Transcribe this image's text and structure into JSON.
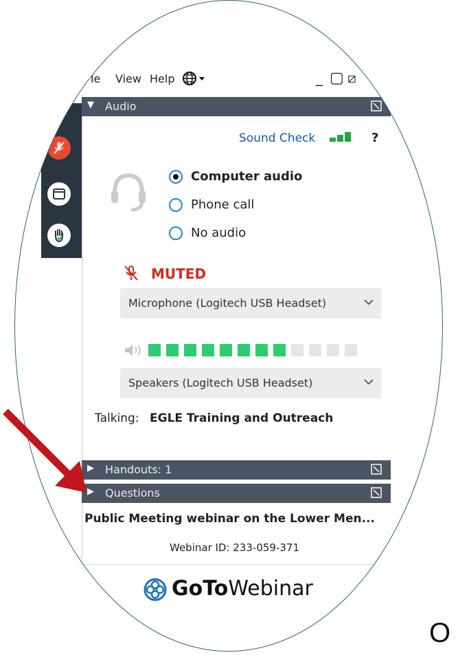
{
  "menubar": {
    "items": [
      "le",
      "View",
      "Help"
    ],
    "globe_icon": "globe-icon",
    "window_controls": [
      "_",
      "▢",
      "⧄",
      "✕"
    ]
  },
  "audio": {
    "section_label": "Audio",
    "sound_check": "Sound Check",
    "help": "?",
    "options": [
      {
        "label": "Computer audio",
        "selected": true
      },
      {
        "label": "Phone call",
        "selected": false
      },
      {
        "label": "No audio",
        "selected": false
      }
    ],
    "muted_label": "MUTED",
    "microphone": "Microphone (Logitech USB Headset)",
    "speaker_level_filled": 8,
    "speaker_level_total": 12,
    "speakers": "Speakers (Logitech USB Headset)",
    "talking_label": "Talking:",
    "talking_name": "EGLE Training and Outreach"
  },
  "sections": {
    "handouts": "Handouts: 1",
    "questions": "Questions"
  },
  "webinar": {
    "title": "Public Meeting webinar on the Lower Men...",
    "id": "Webinar ID: 233-059-371",
    "brand_bold": "GoTo",
    "brand_light": "Webinar"
  },
  "corner_text": "O",
  "colors": {
    "accent_blue": "#1e8ad6",
    "muted_red": "#d42a1e",
    "level_green": "#2ecc71",
    "section_bar": "#4b5563",
    "arrow_red": "#c0161c"
  }
}
